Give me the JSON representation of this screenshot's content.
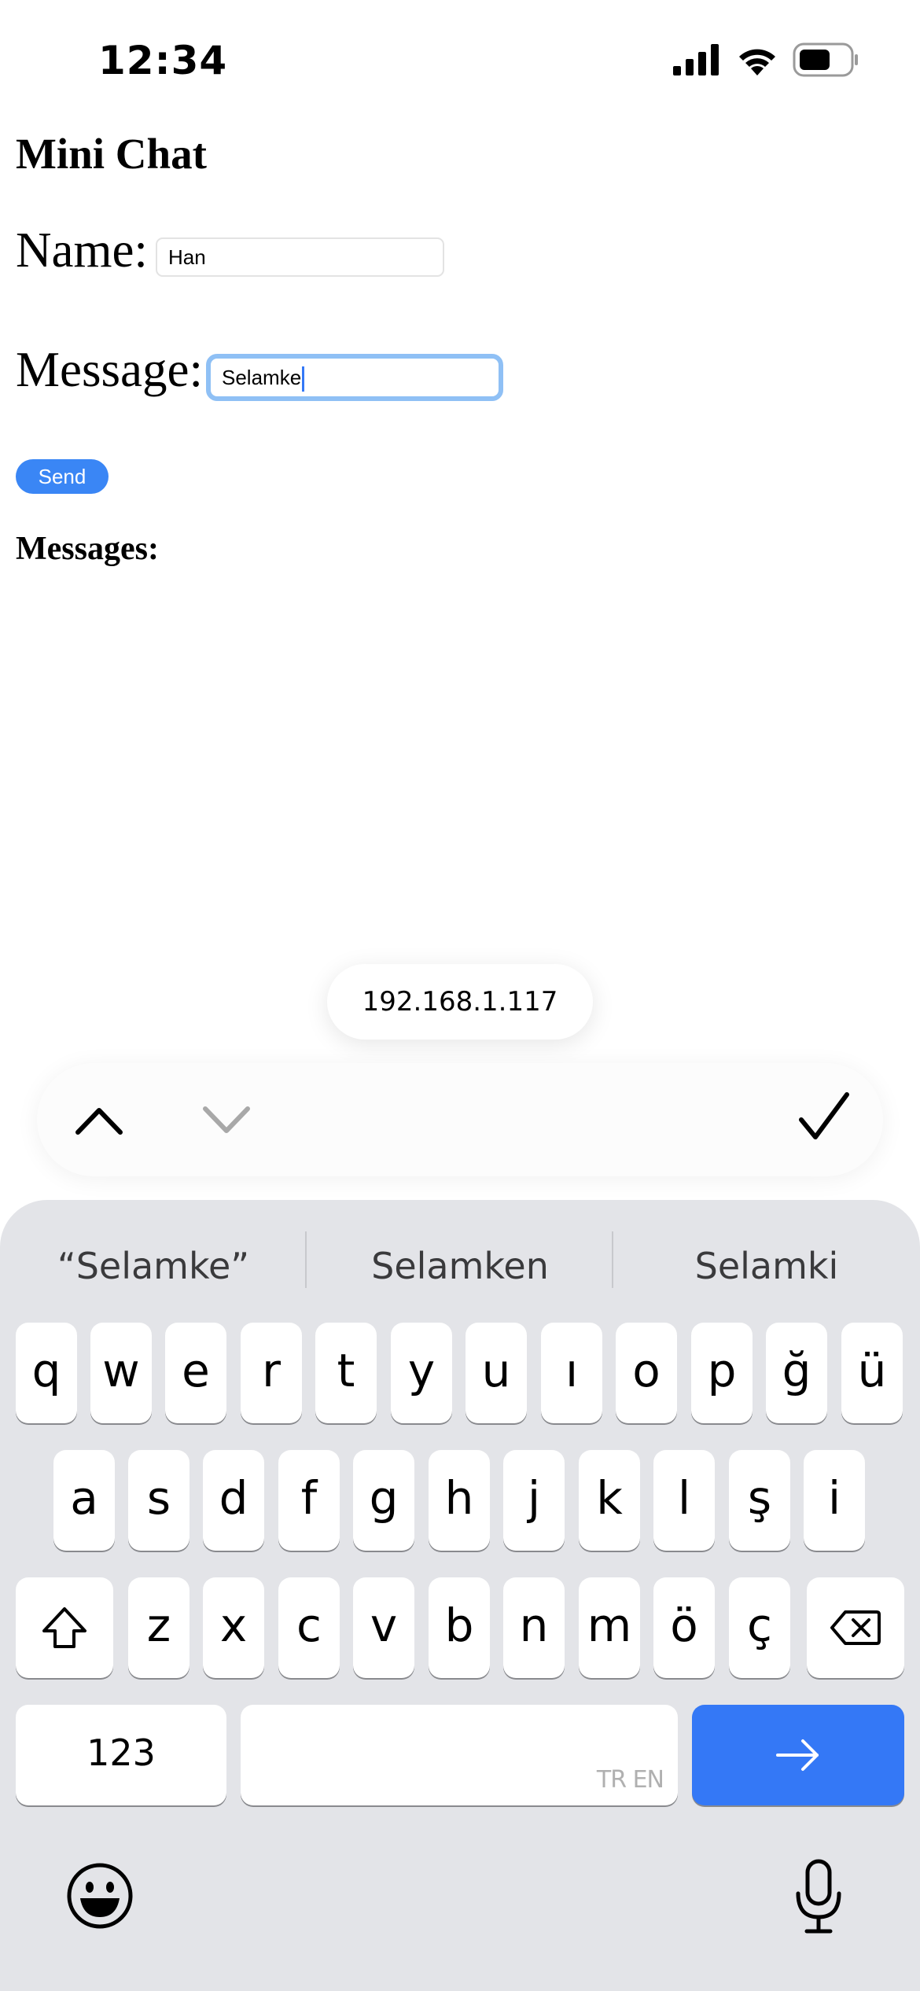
{
  "status_bar": {
    "time": "12:34",
    "icons": [
      "signal-icon",
      "wifi-icon",
      "battery-icon"
    ]
  },
  "page": {
    "title": "Mini Chat",
    "name_label": "Name:",
    "name_value": "Han",
    "message_label": "Message:",
    "message_value": "Selamke",
    "send_label": "Send",
    "messages_heading": "Messages:"
  },
  "autofill": {
    "suggestion": "192.168.1.117"
  },
  "form_nav": {
    "icons": [
      "chevron-up-icon",
      "chevron-down-icon",
      "checkmark-icon"
    ]
  },
  "keyboard": {
    "suggestions": [
      "“Selamke”",
      "Selamken",
      "Selamki"
    ],
    "row1": [
      "q",
      "w",
      "e",
      "r",
      "t",
      "y",
      "u",
      "ı",
      "o",
      "p",
      "ğ",
      "ü"
    ],
    "row2": [
      "a",
      "s",
      "d",
      "f",
      "g",
      "h",
      "j",
      "k",
      "l",
      "ş",
      "i"
    ],
    "row3": [
      "z",
      "x",
      "c",
      "v",
      "b",
      "n",
      "m",
      "ö",
      "ç"
    ],
    "numbers_label": "123",
    "space_hint": "TR EN",
    "icons": [
      "shift-icon",
      "backspace-icon",
      "return-arrow-icon",
      "emoji-icon",
      "microphone-icon"
    ]
  },
  "colors": {
    "accent": "#3478f6",
    "send_button": "#3a86f5",
    "focus_ring": "#8fc0f5",
    "keyboard_bg": "#e3e4e8"
  }
}
